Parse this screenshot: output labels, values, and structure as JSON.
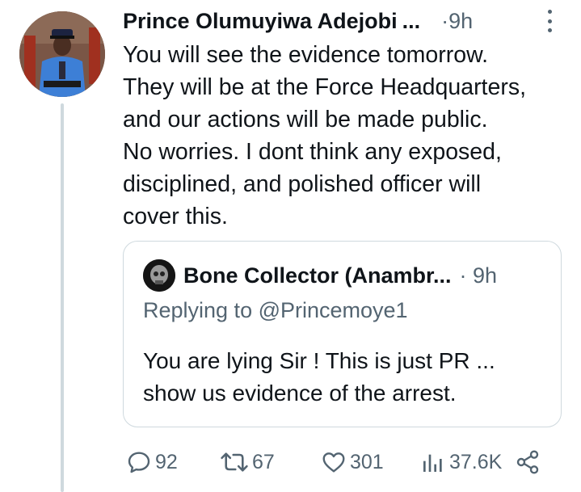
{
  "tweet": {
    "author_name": "Prince Olumuyiwa Adejobi",
    "ellipsis": "...",
    "time": "·9h",
    "text": "You will see the evidence tomorrow.\nThey will be at the Force Headquarters,\nand our actions will be made public.\nNo worries. I dont think any exposed,\ndisciplined, and polished officer will\ncover this."
  },
  "quote": {
    "author_name": "Bone Collector (Anambr...",
    "time": "· 9h",
    "replying_to": "Replying to @Princemoye1",
    "text": "You are lying Sir ! This is just PR ...\nshow us evidence of the arrest."
  },
  "actions": {
    "replies": "92",
    "retweets": "67",
    "likes": "301",
    "views": "37.6K"
  },
  "icons": {
    "reply": "reply-icon",
    "retweet": "retweet-icon",
    "like": "heart-icon",
    "views": "views-chart-icon",
    "share": "share-icon",
    "more": "more-vertical-icon"
  },
  "colors": {
    "text": "#0f1419",
    "secondary": "#536471",
    "border": "#cfd9de"
  }
}
